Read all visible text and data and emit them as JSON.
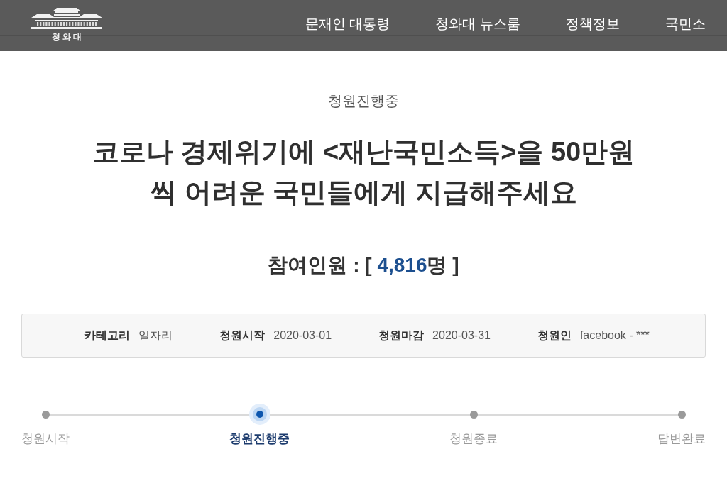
{
  "header": {
    "logo_text": "청 와 대",
    "nav": [
      "문재인 대통령",
      "청와대 뉴스룸",
      "정책정보",
      "국민소"
    ]
  },
  "petition": {
    "status": "청원진행중",
    "title_lines": [
      "코로나 경제위기에 <재난국민소득>을 50만원",
      "씩 어려운 국민들에게 지급해주세요"
    ],
    "participants": {
      "label": "참여인원 :",
      "open": "[",
      "count": "4,816",
      "unit": "명",
      "close": "]"
    },
    "info": [
      {
        "label": "카테고리",
        "value": "일자리"
      },
      {
        "label": "청원시작",
        "value": "2020-03-01"
      },
      {
        "label": "청원마감",
        "value": "2020-03-31"
      },
      {
        "label": "청원인",
        "value": "facebook - ***"
      }
    ]
  },
  "progress": [
    {
      "label": "청원시작",
      "selected": false
    },
    {
      "label": "청원진행중",
      "selected": true
    },
    {
      "label": "청원종료",
      "selected": false
    },
    {
      "label": "답변완료",
      "selected": false
    }
  ]
}
